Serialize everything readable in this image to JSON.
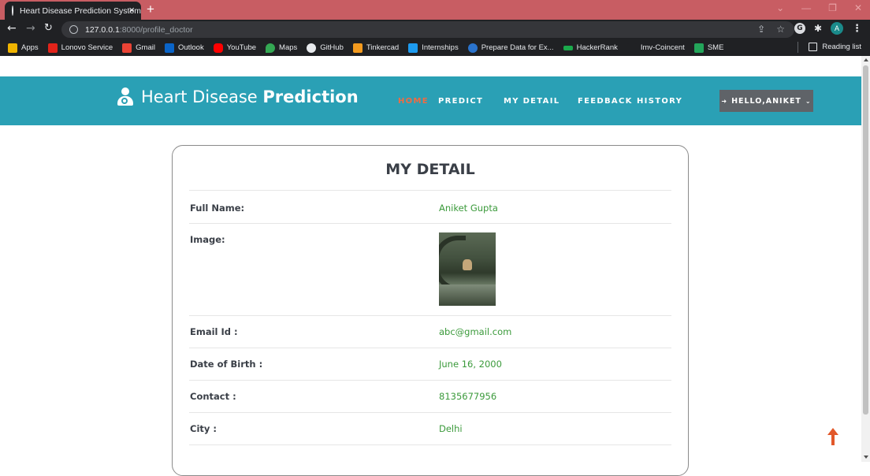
{
  "browser": {
    "tab_title": "Heart Disease Prediction System",
    "tab_close": "×",
    "new_tab": "+",
    "url_host": "127.0.0.1",
    "url_path": ":8000/profile_doctor",
    "profile_initial": "A",
    "bookmarks": [
      {
        "label": "Apps",
        "icon": "apps-grid-icon",
        "color": "#f0b400"
      },
      {
        "label": "Lonovo Service",
        "icon": "lenovo-icon",
        "color": "#e2231a"
      },
      {
        "label": "Gmail",
        "icon": "gmail-icon",
        "color": "#ea4335"
      },
      {
        "label": "Outlook",
        "icon": "outlook-icon",
        "color": "#0a64c8"
      },
      {
        "label": "YouTube",
        "icon": "youtube-icon",
        "color": "#ff0000"
      },
      {
        "label": "Maps",
        "icon": "maps-icon",
        "color": "#34a853"
      },
      {
        "label": "GitHub",
        "icon": "github-icon",
        "color": "#e8eaed"
      },
      {
        "label": "Tinkercad",
        "icon": "tinkercad-icon",
        "color": "#f39a1e"
      },
      {
        "label": "Internships",
        "icon": "internshala-icon",
        "color": "#1d9bf0"
      },
      {
        "label": "Prepare Data for Ex...",
        "icon": "coursera-icon",
        "color": "#2a73cc"
      },
      {
        "label": "HackerRank",
        "icon": "hackerrank-icon",
        "color": "#1ba94c"
      },
      {
        "label": "Imv-Coincent",
        "icon": "blank-page-icon",
        "color": "#202124"
      },
      {
        "label": "SME",
        "icon": "sme-icon",
        "color": "#23a55a"
      }
    ],
    "reading_list": "Reading list"
  },
  "site": {
    "brand_light": "Heart Disease ",
    "brand_bold": "Prediction",
    "nav": {
      "home": "HOME",
      "predict": "PREDICT",
      "my_detail": "MY DETAIL",
      "feedback": "FEEDBACK",
      "history": "HISTORY"
    },
    "user_menu": "HELLO,ANIKET",
    "colors": {
      "navbar": "#2aa0b5",
      "active_link": "#f06b42",
      "value_text": "#3b9a3b"
    }
  },
  "profile": {
    "title": "MY DETAIL",
    "full_name_label": "Full Name:",
    "full_name": "Aniket Gupta",
    "image_label": "Image:",
    "email_label": "Email Id :",
    "email": "abc@gmail.com",
    "dob_label": "Date of Birth :",
    "dob": "June 16, 2000",
    "contact_label": "Contact :",
    "contact": "8135677956",
    "city_label": "City :",
    "city": "Delhi"
  }
}
